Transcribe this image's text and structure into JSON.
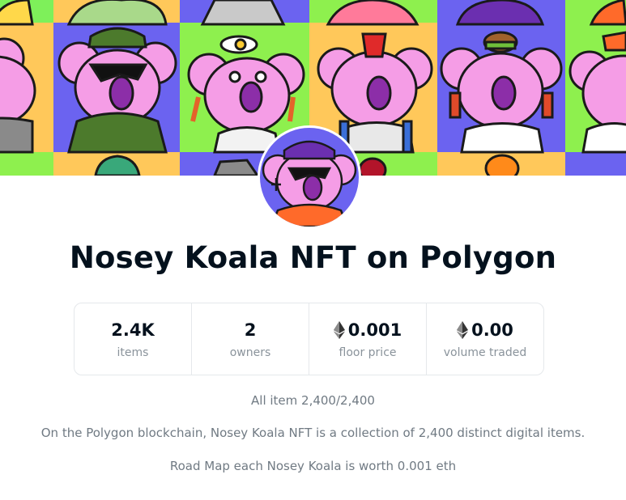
{
  "collection": {
    "title": "Nosey Koala NFT on Polygon"
  },
  "stats": [
    {
      "value": "2.4K",
      "label": "items",
      "icon": ""
    },
    {
      "value": "2",
      "label": "owners",
      "icon": ""
    },
    {
      "value": "0.001",
      "label": "floor price",
      "icon": "ethereum-icon"
    },
    {
      "value": "0.00",
      "label": "volume traded",
      "icon": "ethereum-icon"
    }
  ],
  "info": {
    "items_count": "All item 2,400/2,400",
    "description": "On the Polygon blockchain, Nosey Koala NFT is a collection of 2,400 distinct digital items.",
    "roadmap": "Road Map each Nosey Koala is worth 0.001 eth"
  },
  "colors": {
    "banner_tiles": [
      "#ffc85a",
      "#6b63f0",
      "#8ef04e",
      "#ffc85a",
      "#6b63f0",
      "#8ef04e"
    ],
    "koala_pink": "#f59de6",
    "nose_purple": "#8c2ea8",
    "text_primary": "#04111d",
    "text_secondary": "#8a939b"
  }
}
